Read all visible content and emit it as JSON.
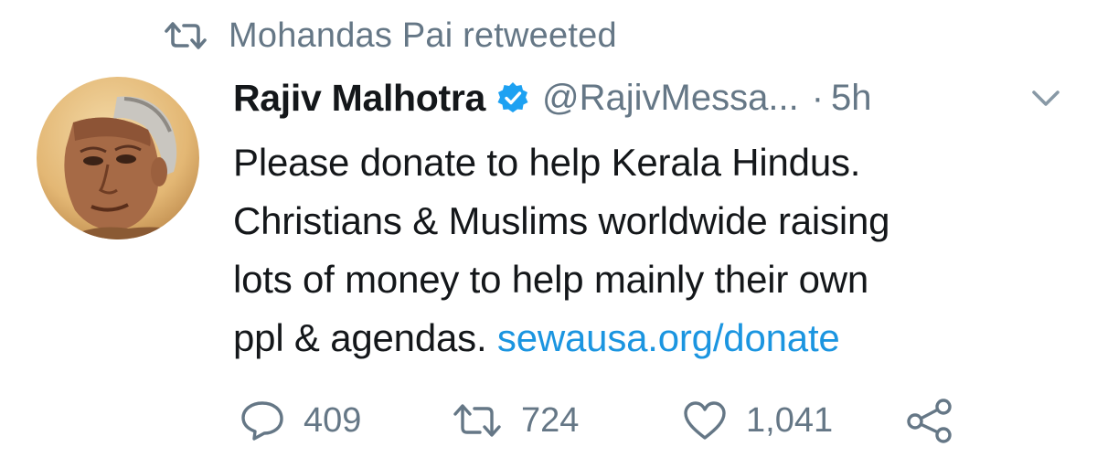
{
  "retweet_context": {
    "icon": "retweet-icon",
    "label": "Mohandas Pai retweeted"
  },
  "tweet": {
    "avatar": "avatar-icon",
    "display_name": "Rajiv Malhotra",
    "verified_icon": "verified-badge-icon",
    "handle": "@RajivMessa...",
    "separator": "·",
    "timestamp": "5h",
    "menu_icon": "chevron-down-icon",
    "text_lines": [
      "Please donate to help Kerala Hindus.",
      "Christians & Muslims worldwide raising",
      "lots of money to help mainly their own"
    ],
    "last_line_text": "ppl & agendas.",
    "link_text": "sewausa.org/donate"
  },
  "actions": {
    "reply_count": "409",
    "retweet_count": "724",
    "like_count": "1,041",
    "reply_icon": "reply-icon",
    "retweet_icon": "retweet-icon",
    "like_icon": "heart-icon",
    "share_icon": "share-icon"
  },
  "colors": {
    "text_primary": "#14171a",
    "text_secondary": "#657786",
    "link": "#1b95e0",
    "verified": "#1da1f2"
  }
}
